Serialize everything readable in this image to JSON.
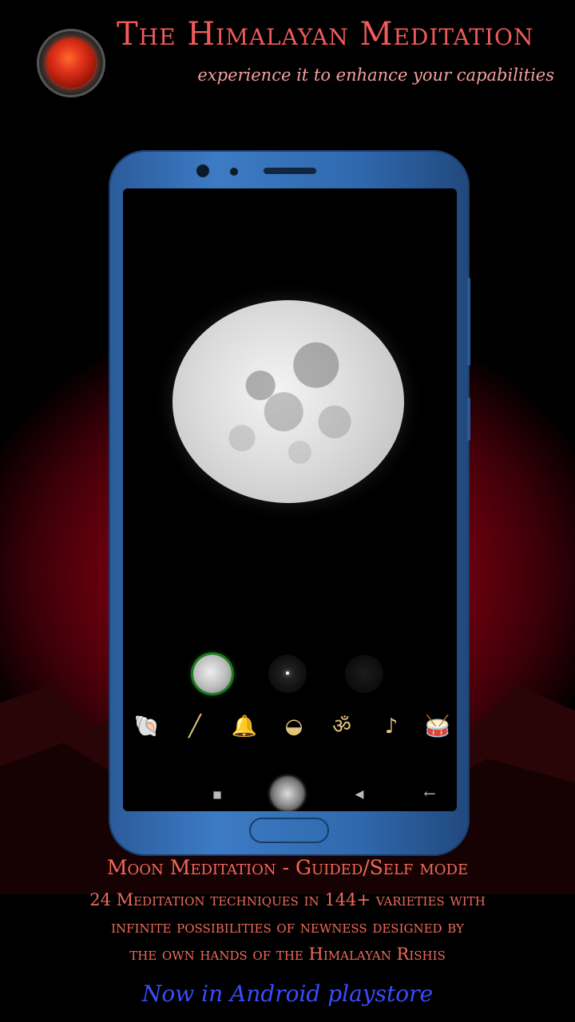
{
  "header": {
    "title": "The Himalayan Meditation",
    "subtitle": "experience it to enhance your capabilities"
  },
  "phone_screen": {
    "main_image": "full-moon",
    "mode_options": [
      {
        "name": "moon-mode-icon",
        "selected": true
      },
      {
        "name": "star-mode-icon",
        "selected": false
      },
      {
        "name": "dark-mode-icon",
        "selected": false
      }
    ],
    "instruments": [
      {
        "name": "conch-icon",
        "glyph": "🐚"
      },
      {
        "name": "flute-icon",
        "glyph": "╱"
      },
      {
        "name": "bell-icon",
        "glyph": "🔔"
      },
      {
        "name": "singing-bowl-icon",
        "glyph": "◒"
      },
      {
        "name": "om-icon",
        "glyph": "ॐ"
      },
      {
        "name": "veena-icon",
        "glyph": "♪"
      },
      {
        "name": "drum-icon",
        "glyph": "🥁"
      }
    ],
    "navbar": {
      "recent_glyph": "■",
      "back_glyph": "◀",
      "return_glyph": "←"
    }
  },
  "footer": {
    "feature_title": "Moon Meditation  - Guided/Self mode",
    "feature_lines": [
      "24 Meditation techniques in 144+ varieties with",
      "infinite possibilities of newness designed by",
      "the own hands of the Himalayan Rishis"
    ],
    "store_text": "Now in Android playstore"
  },
  "colors": {
    "title": "#f05a5a",
    "accent_red": "#a40016",
    "phone_blue": "#3d7bc4",
    "store_blue": "#3a4cff"
  }
}
